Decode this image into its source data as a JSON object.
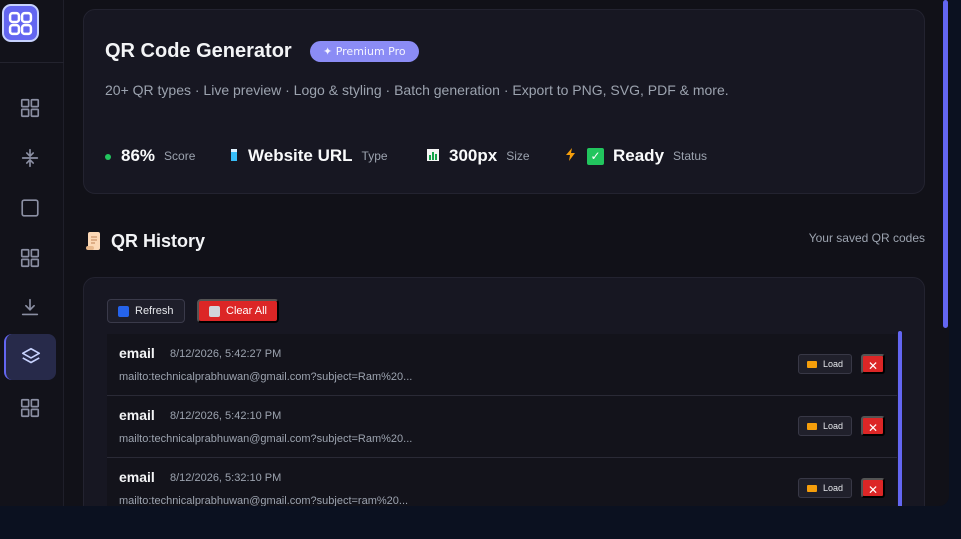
{
  "hero": {
    "title": "QR Code Generator",
    "badge": "✦ Premium Pro",
    "description": "20+ QR types · Live preview · Logo & styling · Batch generation · Export to PNG, SVG, PDF & more.",
    "stats": [
      {
        "icon": "green-dot-icon",
        "value": "86%",
        "label": "Score"
      },
      {
        "icon": "bookmark-icon",
        "value": "Website URL",
        "label": "Type"
      },
      {
        "icon": "chart-icon",
        "value": "300px",
        "label": "Size"
      },
      {
        "icon": "lightning-icon",
        "value": "Ready",
        "label": "Status"
      }
    ]
  },
  "history": {
    "title": "QR History",
    "subtitle": "Your saved QR codes",
    "refresh_label": "Refresh",
    "clear_label": "Clear All",
    "load_label": "Load",
    "delete_label": "✕",
    "items": [
      {
        "type": "email",
        "date": "8/12/2026, 5:42:27 PM",
        "url": "mailto:technicalprabhuwan@gmail.com?subject=Ram%20..."
      },
      {
        "type": "email",
        "date": "8/12/2026, 5:42:10 PM",
        "url": "mailto:technicalprabhuwan@gmail.com?subject=Ram%20..."
      },
      {
        "type": "email",
        "date": "8/12/2026, 5:32:10 PM",
        "url": "mailto:technicalprabhuwan@gmail.com?subject=ram%20..."
      }
    ]
  },
  "sidebar": {
    "items": [
      "grid-icon",
      "arrows-icon",
      "square-icon",
      "grid-icon",
      "download-icon",
      "layers-icon",
      "grid-icon"
    ],
    "active": "layers-icon"
  },
  "colors": {
    "accent": "#6366f1",
    "danger": "#dc2626",
    "success": "#22c55e",
    "background": "#111118"
  }
}
